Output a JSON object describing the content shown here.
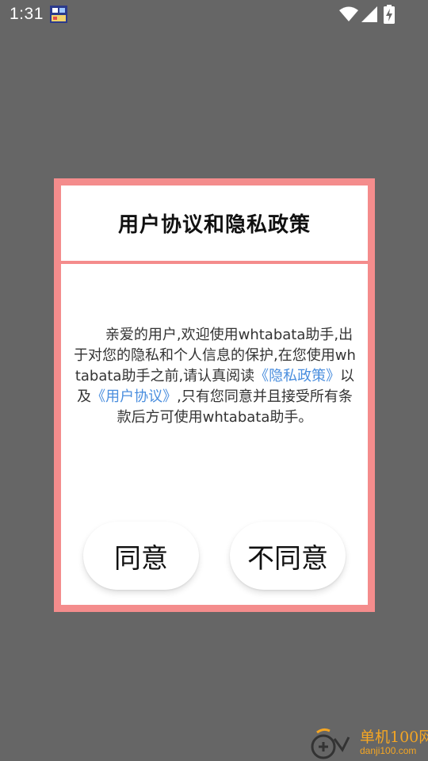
{
  "status_bar": {
    "time": "1:31",
    "icons": [
      "app-notification-icon",
      "wifi-icon",
      "signal-icon",
      "battery-charging-icon"
    ]
  },
  "dialog": {
    "title": "用户协议和隐私政策",
    "body": {
      "intro": "亲爱的用户,欢迎使用whtabata助手,出于对您的隐私和个人信息的保护,在您使用whtabata助手之前,请认真阅读",
      "privacy_link": "《隐私政策》",
      "middle": "以及",
      "agreement_link": "《用户协议》",
      "outro": ",只有您同意并且接受所有条款后方可使用whtabata助手。"
    },
    "agree_label": "同意",
    "disagree_label": "不同意"
  },
  "watermark": {
    "name": "单机100网",
    "url": "danji100.com"
  },
  "colors": {
    "background": "#666666",
    "dialog_border": "#f48c8c",
    "link": "#4a8ede",
    "watermark": "#f5a623"
  }
}
